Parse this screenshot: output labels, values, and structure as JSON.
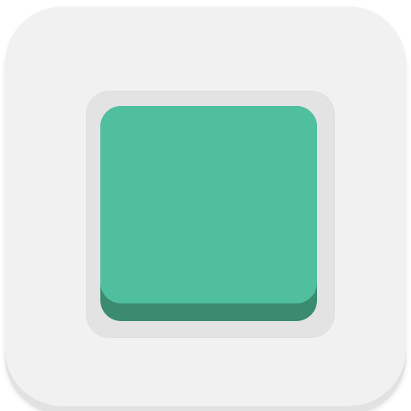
{
  "icon": {
    "name": "stop-app-icon",
    "glyph": "stop-square-icon"
  },
  "colors": {
    "tile_background": "#f1f1f1",
    "tile_edge": "#e2e2e2",
    "frame": "#e3e3e3",
    "square_face": "#4fbf9e",
    "square_side": "#3a8b70"
  }
}
